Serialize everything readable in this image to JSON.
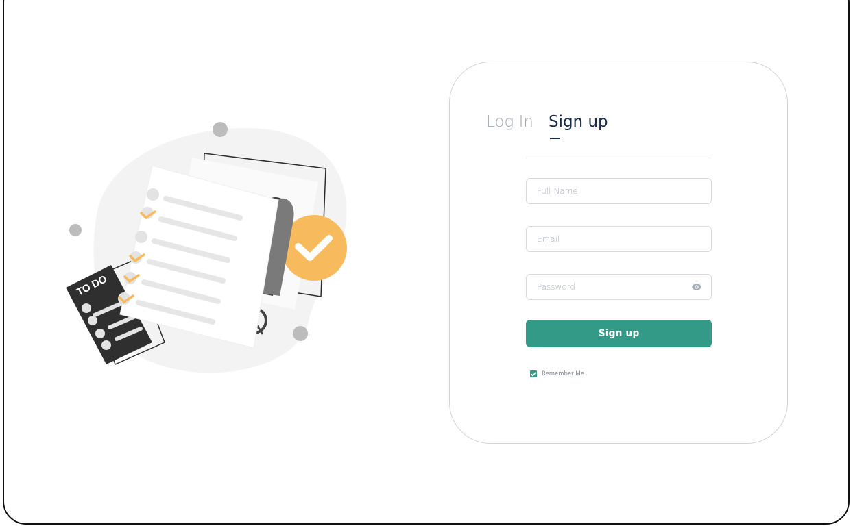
{
  "tabs": {
    "login": "Log In",
    "signup": "Sign up",
    "active": "signup"
  },
  "form": {
    "full_name_placeholder": "Full Name",
    "email_placeholder": "Email",
    "password_placeholder": "Password",
    "submit_label": "Sign up",
    "remember_label": "Remember Me",
    "remember_checked": true
  },
  "illustration": {
    "todo_label": "TO DO"
  },
  "icons": {
    "password_toggle": "eye-icon",
    "remember_check": "checkmark-icon"
  },
  "colors": {
    "accent": "#329a87",
    "tab_active": "#1a2b4a",
    "tab_inactive": "#a4abb6",
    "highlight": "#f7bb5e"
  }
}
